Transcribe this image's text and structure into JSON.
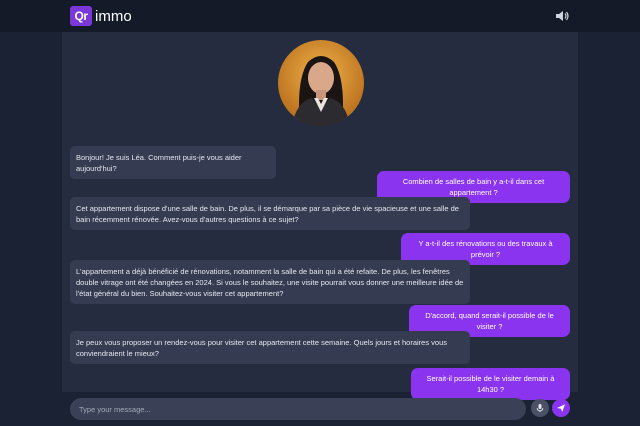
{
  "header": {
    "logo_mark": "Qr",
    "brand": "immo",
    "speaker_icon": "speaker-icon"
  },
  "avatar": {
    "icon": "agent-avatar-photo"
  },
  "messages": [
    {
      "role": "bot",
      "text": "Bonjour! Je suis Léa. Comment puis-je vous aider aujourd'hui?"
    },
    {
      "role": "user",
      "text": "Combien de salles de bain y a-t-il dans cet appartement ?"
    },
    {
      "role": "bot",
      "text": "Cet appartement dispose d'une salle de bain. De plus, il se démarque par sa pièce de vie spacieuse et une salle de bain récemment rénovée. Avez-vous d'autres questions à ce sujet?"
    },
    {
      "role": "user",
      "text": "Y a-t-il des rénovations ou des travaux à prévoir ?"
    },
    {
      "role": "bot",
      "text": "L'appartement a déjà bénéficié de rénovations, notamment la salle de bain qui a été refaite. De plus, les fenêtres double vitrage ont été changées en 2024. Si vous le souhaitez, une visite pourrait vous donner une meilleure idée de l'état général du bien. Souhaitez-vous visiter cet appartement?"
    },
    {
      "role": "user",
      "text": "D'accord, quand serait-il possible de le visiter ?"
    },
    {
      "role": "bot",
      "text": "Je peux vous proposer un rendez-vous pour visiter cet appartement cette semaine. Quels jours et horaires vous conviendraient le mieux?"
    },
    {
      "role": "user",
      "text": "Serait-il possible de le visiter demain à 14h30 ?"
    }
  ],
  "composer": {
    "placeholder": "Type your message...",
    "mic_icon": "microphone-icon",
    "send_icon": "send-icon"
  },
  "colors": {
    "accent": "#8a34f0",
    "background": "#1b2233",
    "chat_panel": "#252c3f",
    "bot_bubble": "#353c52",
    "topbar": "#141a28"
  }
}
